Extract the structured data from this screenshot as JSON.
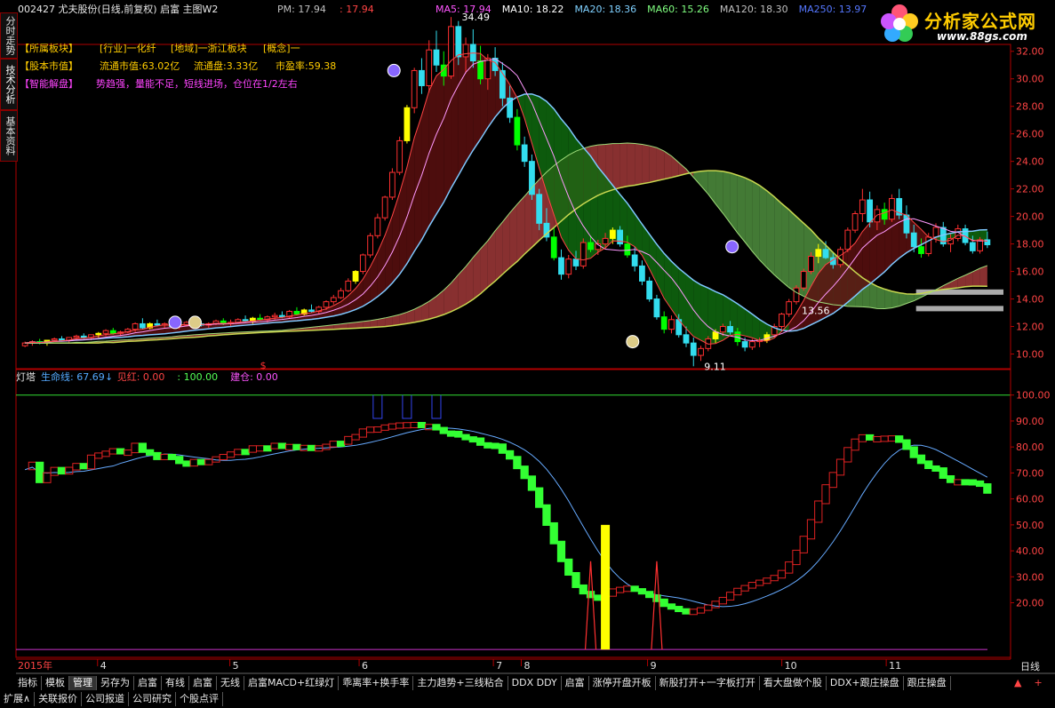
{
  "header": {
    "stock": "002427 尤夫股份(日线,前复权) 启富 主图W2",
    "pm_label": "PM: 17.94",
    "price_flag": ": 17.94",
    "ma": [
      {
        "label": "MA5: 17.94",
        "color": "#ff55ff"
      },
      {
        "label": "MA10: 18.22",
        "color": "#ffffff"
      },
      {
        "label": "MA20: 18.36",
        "color": "#7fd0ff"
      },
      {
        "label": "MA60: 15.26",
        "color": "#80ff80"
      },
      {
        "label": "MA120: 18.30",
        "color": "#c0c0c0"
      },
      {
        "label": "MA250: 13.97",
        "color": "#5577ff"
      }
    ]
  },
  "info": {
    "row1": {
      "tag": "【所属板块】",
      "industry": "[行业]一化纤",
      "region": "[地域]一浙江板块",
      "concept": "[概念]一"
    },
    "row2": {
      "tag": "【股本市值】",
      "mcap": "流通市值:63.02亿",
      "shares": "流通盘:3.33亿",
      "pe": "市盈率:59.38"
    },
    "row3": {
      "tag": "【智能解盘】",
      "text": "势趋强，量能不足，短线进场，仓位在1/2左右"
    }
  },
  "logo": {
    "text": "分析家公式网",
    "url": "www.88gs.com"
  },
  "sidetabs": [
    "分时走势",
    "技术分析",
    "基本资料"
  ],
  "chart_data": [
    {
      "type": "candlestick",
      "name": "main",
      "y_ticks": [
        10.0,
        12.0,
        14.0,
        16.0,
        18.0,
        20.0,
        22.0,
        24.0,
        26.0,
        28.0,
        30.0,
        32.0
      ],
      "ylim": [
        9.0,
        32.5
      ],
      "ohlc": [
        [
          10.6,
          10.9,
          10.5,
          10.8
        ],
        [
          10.8,
          11.0,
          10.6,
          10.9
        ],
        [
          10.9,
          11.1,
          10.7,
          10.8
        ],
        [
          10.8,
          11.0,
          10.6,
          11.0
        ],
        [
          11.0,
          11.2,
          10.9,
          11.1
        ],
        [
          11.1,
          11.3,
          10.9,
          11.0
        ],
        [
          11.0,
          11.2,
          10.8,
          11.2
        ],
        [
          11.2,
          11.4,
          11.0,
          11.3
        ],
        [
          11.3,
          11.5,
          11.1,
          11.2
        ],
        [
          11.2,
          11.4,
          11.0,
          11.4
        ],
        [
          11.4,
          11.6,
          11.2,
          11.5
        ],
        [
          11.5,
          11.8,
          11.3,
          11.7
        ],
        [
          11.7,
          11.9,
          11.4,
          11.5
        ],
        [
          11.5,
          11.7,
          11.3,
          11.6
        ],
        [
          11.6,
          11.9,
          11.5,
          11.8
        ],
        [
          11.8,
          12.3,
          11.6,
          12.2
        ],
        [
          12.2,
          12.6,
          11.8,
          11.9
        ],
        [
          11.9,
          12.3,
          11.8,
          12.2
        ],
        [
          12.2,
          12.5,
          12.0,
          12.1
        ],
        [
          12.1,
          12.3,
          11.9,
          12.2
        ],
        [
          12.2,
          12.4,
          11.9,
          12.0
        ],
        [
          12.0,
          12.2,
          11.8,
          12.1
        ],
        [
          12.1,
          12.4,
          12.0,
          12.3
        ],
        [
          12.3,
          12.5,
          12.1,
          12.2
        ],
        [
          12.2,
          12.4,
          12.0,
          12.1
        ],
        [
          12.1,
          12.3,
          11.9,
          12.2
        ],
        [
          12.2,
          12.5,
          12.1,
          12.4
        ],
        [
          12.4,
          12.6,
          12.1,
          12.2
        ],
        [
          12.2,
          12.5,
          12.0,
          12.3
        ],
        [
          12.3,
          12.6,
          12.2,
          12.5
        ],
        [
          12.5,
          12.8,
          12.3,
          12.4
        ],
        [
          12.4,
          12.7,
          12.2,
          12.6
        ],
        [
          12.6,
          12.9,
          12.4,
          12.5
        ],
        [
          12.5,
          12.8,
          12.3,
          12.7
        ],
        [
          12.7,
          13.0,
          12.5,
          12.8
        ],
        [
          12.8,
          13.1,
          12.6,
          12.7
        ],
        [
          12.7,
          13.2,
          12.6,
          13.1
        ],
        [
          13.1,
          13.4,
          12.8,
          12.9
        ],
        [
          12.9,
          13.3,
          12.8,
          13.2
        ],
        [
          13.2,
          13.6,
          13.0,
          13.1
        ],
        [
          13.1,
          13.5,
          12.9,
          13.4
        ],
        [
          13.4,
          13.9,
          13.2,
          13.8
        ],
        [
          13.8,
          14.3,
          13.6,
          14.1
        ],
        [
          14.1,
          14.8,
          14.0,
          14.6
        ],
        [
          14.6,
          15.5,
          14.5,
          15.3
        ],
        [
          15.3,
          16.1,
          15.1,
          16.0
        ],
        [
          16.0,
          17.3,
          15.8,
          17.2
        ],
        [
          17.2,
          18.8,
          17.0,
          18.6
        ],
        [
          18.6,
          20.2,
          18.4,
          19.9
        ],
        [
          19.9,
          21.5,
          19.7,
          21.4
        ],
        [
          21.4,
          23.5,
          21.2,
          23.2
        ],
        [
          23.2,
          25.8,
          23.0,
          25.5
        ],
        [
          25.5,
          28.1,
          25.3,
          27.9
        ],
        [
          27.9,
          30.8,
          27.5,
          30.6
        ],
        [
          30.6,
          31.5,
          28.9,
          29.5
        ],
        [
          29.5,
          32.8,
          29.0,
          32.1
        ],
        [
          32.1,
          33.5,
          30.5,
          31.0
        ],
        [
          31.0,
          32.0,
          29.5,
          30.2
        ],
        [
          30.2,
          34.49,
          30.0,
          33.8
        ],
        [
          33.8,
          34.2,
          31.0,
          31.6
        ],
        [
          31.6,
          33.0,
          30.4,
          32.5
        ],
        [
          32.5,
          33.6,
          30.8,
          31.3
        ],
        [
          31.3,
          32.4,
          29.6,
          30.0
        ],
        [
          30.0,
          31.8,
          29.2,
          31.5
        ],
        [
          31.5,
          32.3,
          30.2,
          30.6
        ],
        [
          30.6,
          31.2,
          28.0,
          28.6
        ],
        [
          28.6,
          29.5,
          26.8,
          27.2
        ],
        [
          27.2,
          27.8,
          24.8,
          25.2
        ],
        [
          25.2,
          25.8,
          23.6,
          24.0
        ],
        [
          24.0,
          24.5,
          21.2,
          21.6
        ],
        [
          21.6,
          22.0,
          19.0,
          19.5
        ],
        [
          19.5,
          20.6,
          18.2,
          18.5
        ],
        [
          18.5,
          19.2,
          16.8,
          17.0
        ],
        [
          17.0,
          17.6,
          15.4,
          15.8
        ],
        [
          15.8,
          17.2,
          15.5,
          16.9
        ],
        [
          16.9,
          17.5,
          16.1,
          16.4
        ],
        [
          16.4,
          18.4,
          16.2,
          18.1
        ],
        [
          18.1,
          18.6,
          17.4,
          17.6
        ],
        [
          17.6,
          18.3,
          17.2,
          18.0
        ],
        [
          18.0,
          18.8,
          17.6,
          18.4
        ],
        [
          18.4,
          19.2,
          18.0,
          19.0
        ],
        [
          19.0,
          19.3,
          17.8,
          18.0
        ],
        [
          18.0,
          18.6,
          17.0,
          17.2
        ],
        [
          17.2,
          17.8,
          16.0,
          16.4
        ],
        [
          16.4,
          16.8,
          15.0,
          15.3
        ],
        [
          15.3,
          15.6,
          13.8,
          14.0
        ],
        [
          14.0,
          14.3,
          12.5,
          12.7
        ],
        [
          12.7,
          13.1,
          11.5,
          11.8
        ],
        [
          11.8,
          12.8,
          11.5,
          12.5
        ],
        [
          12.5,
          12.9,
          11.2,
          11.4
        ],
        [
          11.4,
          12.0,
          10.5,
          10.8
        ],
        [
          10.8,
          11.2,
          9.11,
          9.9
        ],
        [
          9.9,
          10.6,
          9.5,
          10.4
        ],
        [
          10.4,
          11.3,
          10.2,
          11.1
        ],
        [
          11.1,
          11.8,
          10.8,
          11.6
        ],
        [
          11.6,
          12.2,
          11.3,
          12.0
        ],
        [
          12.0,
          12.4,
          11.4,
          11.6
        ],
        [
          11.6,
          11.9,
          10.6,
          10.9
        ],
        [
          10.9,
          11.2,
          10.2,
          10.5
        ],
        [
          10.5,
          11.1,
          10.3,
          10.9
        ],
        [
          10.9,
          11.2,
          10.5,
          11.0
        ],
        [
          11.0,
          11.6,
          10.8,
          11.4
        ],
        [
          11.4,
          12.2,
          11.2,
          12.0
        ],
        [
          12.0,
          13.0,
          11.8,
          12.9
        ],
        [
          12.9,
          14.0,
          12.7,
          13.8
        ],
        [
          13.8,
          15.0,
          13.6,
          14.8
        ],
        [
          14.8,
          16.2,
          14.6,
          16.0
        ],
        [
          16.0,
          17.4,
          15.8,
          17.1
        ],
        [
          17.1,
          18.0,
          16.6,
          17.6
        ],
        [
          17.6,
          18.2,
          16.9,
          17.0
        ],
        [
          17.0,
          17.4,
          16.2,
          16.5
        ],
        [
          16.5,
          17.8,
          16.3,
          17.6
        ],
        [
          17.6,
          19.2,
          17.4,
          19.0
        ],
        [
          19.0,
          20.4,
          18.8,
          20.2
        ],
        [
          20.2,
          22.0,
          19.6,
          21.2
        ],
        [
          21.2,
          21.8,
          19.2,
          19.6
        ],
        [
          19.6,
          20.8,
          19.0,
          20.5
        ],
        [
          20.5,
          21.0,
          19.4,
          19.8
        ],
        [
          19.8,
          21.6,
          19.6,
          21.3
        ],
        [
          21.3,
          22.0,
          19.8,
          20.1
        ],
        [
          20.1,
          20.8,
          18.4,
          18.8
        ],
        [
          18.8,
          19.4,
          17.4,
          17.8
        ],
        [
          17.8,
          18.4,
          17.0,
          17.3
        ],
        [
          17.3,
          18.8,
          17.1,
          18.5
        ],
        [
          18.5,
          19.5,
          18.1,
          19.2
        ],
        [
          19.2,
          19.6,
          17.8,
          18.0
        ],
        [
          18.0,
          18.7,
          17.4,
          18.4
        ],
        [
          18.4,
          19.4,
          18.2,
          19.1
        ],
        [
          19.1,
          19.4,
          17.9,
          18.1
        ],
        [
          18.1,
          18.6,
          17.3,
          17.5
        ],
        [
          17.5,
          18.5,
          17.3,
          18.3
        ],
        [
          18.3,
          18.9,
          17.7,
          17.94
        ]
      ],
      "price_labels": [
        "34.49",
        "9.11",
        "13.56"
      ],
      "dollar_marker": "$"
    },
    {
      "type": "line",
      "name": "indicator",
      "title": "灯塔",
      "legend": [
        {
          "label": "生命线: 67.69",
          "color": "#55aaff"
        },
        {
          "label": "见红: 0.00",
          "color": "#ff4444"
        },
        {
          "label": ": 100.00",
          "color": "#55ff55"
        },
        {
          "label": "建仓: 0.00",
          "color": "#ff55ff"
        }
      ],
      "y_ticks": [
        20.0,
        30.0,
        40.0,
        50.0,
        60.0,
        70.0,
        80.0,
        90.0,
        100.0
      ],
      "ylim": [
        0,
        104
      ]
    }
  ],
  "x_axis": {
    "year": "2015年",
    "months": [
      "4",
      "5",
      "6",
      "7",
      "8",
      "9",
      "10",
      "11"
    ],
    "period": "日线",
    "nav_icons": [
      "▲",
      "+",
      "-"
    ]
  },
  "toolbar": [
    "指标",
    "模板",
    "管理",
    "另存为",
    "启富",
    "有线",
    "启富",
    "无线",
    "启富MACD+红绿灯",
    "乖离率+换手率",
    "主力趋势+三线粘合",
    "DDX DDY",
    "启富",
    "涨停开盘开板",
    "新股打开+一字板打开",
    "看大盘做个股",
    "DDX+跟庄操盘",
    "跟庄操盘"
  ],
  "bottom_tabs": [
    "扩展∧",
    "关联报价",
    "公司报道",
    "公司研究",
    "个股点评"
  ]
}
